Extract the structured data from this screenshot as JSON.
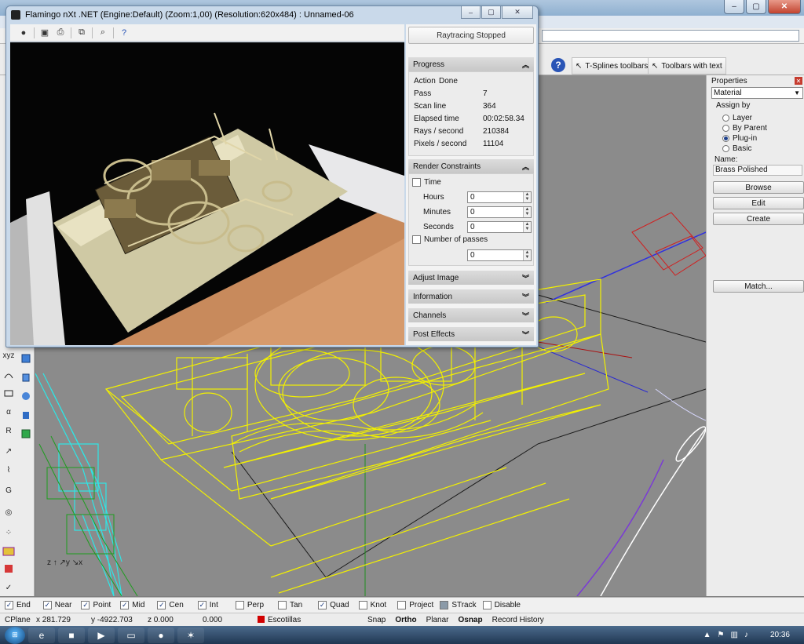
{
  "flamingo": {
    "title": "Flamingo nXt .NET (Engine:Default) (Zoom:1,00) (Resolution:620x484) : Unnamed-06",
    "raytracing_status": "Raytracing Stopped",
    "progress": {
      "header": "Progress",
      "action_label": "Action",
      "action_value": "Done",
      "rows": [
        {
          "label": "Pass",
          "value": "7"
        },
        {
          "label": "Scan line",
          "value": "364"
        },
        {
          "label": "Elapsed time",
          "value": "00:02:58.34"
        },
        {
          "label": "Rays / second",
          "value": "210384"
        },
        {
          "label": "Pixels / second",
          "value": "11104"
        }
      ]
    },
    "render_constraints": {
      "header": "Render Constraints",
      "time_label": "Time",
      "hours_label": "Hours",
      "hours_value": "0",
      "minutes_label": "Minutes",
      "minutes_value": "0",
      "seconds_label": "Seconds",
      "seconds_value": "0",
      "passes_label": "Number of passes",
      "passes_value": "0"
    },
    "sections": [
      "Adjust Image",
      "Information",
      "Channels",
      "Post Effects"
    ]
  },
  "toolbar_tabs": {
    "tsplines": "T-Splines toolbars",
    "text": "Toolbars with text"
  },
  "properties": {
    "title": "Properties",
    "dropdown": "Material",
    "assign_by": "Assign by",
    "options": [
      {
        "label": "Layer",
        "selected": false
      },
      {
        "label": "By Parent",
        "selected": false
      },
      {
        "label": "Plug-in",
        "selected": true
      },
      {
        "label": "Basic",
        "selected": false
      }
    ],
    "name_label": "Name:",
    "name_value": "Brass Polished",
    "buttons": {
      "browse": "Browse",
      "edit": "Edit",
      "create": "Create",
      "match": "Match..."
    }
  },
  "osnap": [
    {
      "label": "End",
      "checked": true
    },
    {
      "label": "Near",
      "checked": true
    },
    {
      "label": "Point",
      "checked": true
    },
    {
      "label": "Mid",
      "checked": true
    },
    {
      "label": "Cen",
      "checked": true
    },
    {
      "label": "Int",
      "checked": true
    },
    {
      "label": "Perp",
      "checked": false
    },
    {
      "label": "Tan",
      "checked": false
    },
    {
      "label": "Quad",
      "checked": true
    },
    {
      "label": "Knot",
      "checked": false
    },
    {
      "label": "Project",
      "checked": false
    },
    {
      "label": "STrack",
      "checked": false
    },
    {
      "label": "Disable",
      "checked": false
    }
  ],
  "status": {
    "cplane": "CPlane",
    "x": "x 281.729",
    "y": "y -4922.703",
    "z": "z 0.000",
    "extra": "0.000",
    "layer": "Escotillas",
    "snap": "Snap",
    "ortho": "Ortho",
    "planar": "Planar",
    "osnap": "Osnap",
    "record": "Record History"
  },
  "taskbar": {
    "clock": "20:36"
  },
  "colors": {
    "wire_yellow": "#f2f000",
    "wire_cyan": "#2ee6e6",
    "wire_green": "#1e9c1e",
    "viewport_bg": "#8b8b8b",
    "layer_red": "#d10000"
  }
}
